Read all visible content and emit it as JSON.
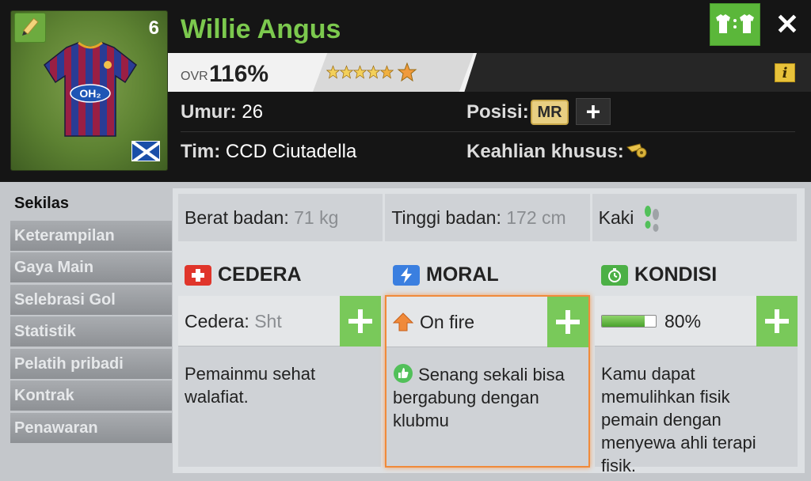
{
  "player": {
    "number": "6",
    "name": "Willie Angus",
    "ovr_label": "OVR",
    "ovr_value": "116%",
    "stars": 6,
    "age_label": "Umur:",
    "age_value": "26",
    "team_label": "Tim:",
    "team_value": "CCD Ciutadella",
    "position_label": "Posisi:",
    "position_value": "MR",
    "specialty_label": "Keahlian khusus:"
  },
  "icons": {
    "edit": "pencil-icon",
    "compare": "jersey-compare-icon",
    "close": "close-icon",
    "info": "info-icon",
    "nationality": "scotland-flag-icon",
    "specialty": "whistle-icon",
    "foot": "foot-icon"
  },
  "buttons": {
    "close": "✕",
    "info": "i",
    "position_add": "+"
  },
  "sidebar": {
    "items": [
      {
        "label": "Sekilas",
        "active": true
      },
      {
        "label": "Keterampilan"
      },
      {
        "label": "Gaya Main"
      },
      {
        "label": "Selebrasi Gol"
      },
      {
        "label": "Statistik"
      },
      {
        "label": "Pelatih pribadi"
      },
      {
        "label": "Kontrak"
      },
      {
        "label": "Penawaran"
      }
    ]
  },
  "stats": {
    "weight_label": "Berat badan:",
    "weight_value": "71 kg",
    "height_label": "Tinggi badan:",
    "height_value": "172 cm",
    "foot_label": "Kaki"
  },
  "sections": {
    "injury": {
      "title": "CEDERA",
      "bar_label": "Cedera:",
      "bar_value": "Sht",
      "desc": "Pemainmu sehat walafiat."
    },
    "morale": {
      "title": "MORAL",
      "bar_value": "On fire",
      "desc": "Senang sekali bisa bergabung dengan klubmu"
    },
    "condition": {
      "title": "KONDISI",
      "bar_value": "80%",
      "fraction": 0.8,
      "desc": "Kamu dapat memulihkan fisik pemain dengan menyewa ahli terapi fisik."
    }
  },
  "colors": {
    "name": "#7cc94e",
    "accent_green": "#5bb73a",
    "morale_border": "#f08a3a"
  }
}
